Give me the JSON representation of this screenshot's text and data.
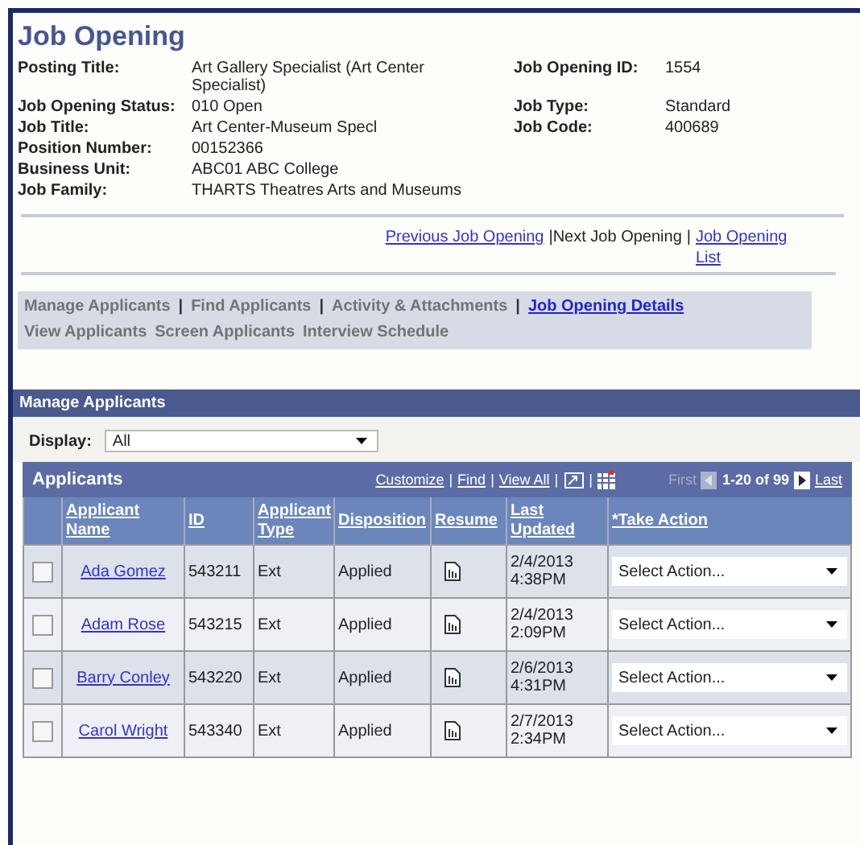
{
  "page_title": "Job Opening",
  "left_fields": [
    {
      "label": "Posting Title:",
      "value": "Art Gallery Specialist (Art Center Specialist)"
    },
    {
      "label": "Job Opening Status:",
      "value": "010 Open"
    },
    {
      "label": "Job Title:",
      "value": "Art Center-Museum Specl"
    },
    {
      "label": "Position Number:",
      "value": "00152366"
    },
    {
      "label": "Business Unit:",
      "value": "ABC01   ABC College"
    },
    {
      "label": "Job Family:",
      "value": "THARTS   Theatres Arts and Museums"
    }
  ],
  "right_fields": [
    {
      "label": "Job Opening ID:",
      "value": "1554"
    },
    {
      "label": "Job Type:",
      "value": "Standard"
    },
    {
      "label": "Job Code:",
      "value": "400689"
    }
  ],
  "nav_links": [
    {
      "text": "Previous Job Opening",
      "kind": "link"
    },
    {
      "text": "|Next Job Opening",
      "kind": "plain"
    },
    {
      "text": "|",
      "kind": "plain"
    },
    {
      "text": "Job Opening List",
      "kind": "link"
    }
  ],
  "tab_rows": [
    [
      {
        "text": "Manage Applicants",
        "kind": "plain"
      },
      {
        "text": "|",
        "kind": "separator"
      },
      {
        "text": "Find Applicants",
        "kind": "plain"
      },
      {
        "text": "|",
        "kind": "separator"
      },
      {
        "text": "Activity & Attachments",
        "kind": "plain"
      },
      {
        "text": "|",
        "kind": "separator"
      },
      {
        "text": "Job Opening Details",
        "kind": "link"
      }
    ],
    [
      {
        "text": "View Applicants",
        "kind": "plain"
      },
      {
        "text": "Screen Applicants",
        "kind": "plain"
      },
      {
        "text": "Interview Schedule",
        "kind": "plain"
      }
    ]
  ],
  "section_title": "Manage Applicants",
  "display": {
    "label": "Display:",
    "value": "All"
  },
  "grid": {
    "title": "Applicants",
    "tools": [
      {
        "text": "Customize",
        "kind": "link"
      },
      {
        "text": "|",
        "kind": "separator"
      },
      {
        "text": "Find",
        "kind": "link"
      },
      {
        "text": "|",
        "kind": "separator"
      },
      {
        "text": "View All",
        "kind": "link"
      },
      {
        "text": "|",
        "kind": "separator"
      },
      {
        "kind": "zoom"
      },
      {
        "text": "|",
        "kind": "separator"
      },
      {
        "kind": "download"
      }
    ],
    "pager": {
      "first": "First",
      "range": "1-20 of 99",
      "last": "Last"
    },
    "columns": [
      "Applicant Name",
      "ID",
      "Applicant Type",
      "Disposition",
      "Resume",
      "Last Updated",
      "*Take Action"
    ],
    "rows": [
      {
        "checked": false,
        "name": "Ada Gomez",
        "id": "543211",
        "type": "Ext",
        "disposition": "Applied",
        "updated": "2/4/2013 4:38PM",
        "action": "Select Action..."
      },
      {
        "checked": false,
        "name": "Adam Rose",
        "id": "543215",
        "type": "Ext",
        "disposition": "Applied",
        "updated": "2/4/2013 2:09PM",
        "action": "Select Action..."
      },
      {
        "checked": false,
        "name": "Barry Conley",
        "id": "543220",
        "type": "Ext",
        "disposition": "Applied",
        "updated": "2/6/2013 4:31PM",
        "action": "Select Action..."
      },
      {
        "checked": false,
        "name": "Carol Wright",
        "id": "543340",
        "type": "Ext",
        "disposition": "Applied",
        "updated": "2/7/2013 2:34PM",
        "action": "Select Action..."
      }
    ]
  }
}
